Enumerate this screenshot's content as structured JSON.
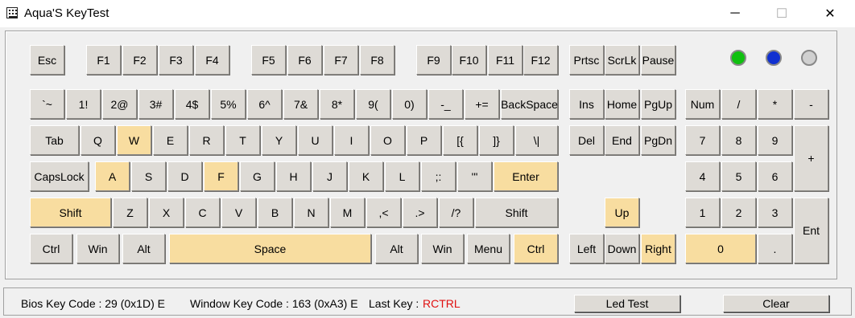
{
  "window": {
    "title": "Aqua'S KeyTest",
    "minimize_glyph": "─",
    "maximize_glyph": "☐",
    "close_glyph": "✕"
  },
  "keys": {
    "esc": "Esc",
    "f1": "F1",
    "f2": "F2",
    "f3": "F3",
    "f4": "F4",
    "f5": "F5",
    "f6": "F6",
    "f7": "F7",
    "f8": "F8",
    "f9": "F9",
    "f10": "F10",
    "f11": "F11",
    "f12": "F12",
    "prtsc": "Prtsc",
    "scrlk": "ScrLk",
    "pause": "Pause",
    "backtick": "`~",
    "k1": "1!",
    "k2": "2@",
    "k3": "3#",
    "k4": "4$",
    "k5": "5%",
    "k6": "6^",
    "k7": "7&",
    "k8": "8*",
    "k9": "9(",
    "k0": "0)",
    "minus": "-_",
    "equals": "+=",
    "backspace": "BackSpace",
    "ins": "Ins",
    "home": "Home",
    "pgup": "PgUp",
    "num": "Num",
    "np_div": "/",
    "np_mul": "*",
    "np_sub": "-",
    "tab": "Tab",
    "q": "Q",
    "w": "W",
    "e": "E",
    "r": "R",
    "t": "T",
    "y": "Y",
    "u": "U",
    "i": "I",
    "o": "O",
    "p": "P",
    "lbracket": "[{",
    "rbracket": "]}",
    "backslash": "\\|",
    "del": "Del",
    "end": "End",
    "pgdn": "PgDn",
    "np7": "7",
    "np8": "8",
    "np9": "9",
    "np_add": "+",
    "capslock": "CapsLock",
    "a": "A",
    "s": "S",
    "d": "D",
    "f": "F",
    "g": "G",
    "h": "H",
    "j": "J",
    "k": "K",
    "l": "L",
    "semicolon": ";:",
    "quote": "'\"",
    "enter": "Enter",
    "np4": "4",
    "np5": "5",
    "np6": "6",
    "lshift": "Shift",
    "z": "Z",
    "x": "X",
    "c": "C",
    "v": "V",
    "b": "B",
    "n": "N",
    "m": "M",
    "comma": ",<",
    "period": ".>",
    "slash": "/?",
    "rshift": "Shift",
    "up": "Up",
    "np1": "1",
    "np2": "2",
    "np3": "3",
    "np_enter": "Ent",
    "lctrl": "Ctrl",
    "lwin": "Win",
    "lalt": "Alt",
    "space": "Space",
    "ralt": "Alt",
    "rwin": "Win",
    "menu": "Menu",
    "rctrl": "Ctrl",
    "left": "Left",
    "down": "Down",
    "right": "Right",
    "np0": "0",
    "np_dot": "."
  },
  "highlighted_keys": [
    "w",
    "a",
    "f",
    "enter",
    "lshift",
    "space",
    "rctrl",
    "up",
    "right",
    "np0"
  ],
  "leds": {
    "num_lock_color": "#10c010",
    "caps_lock_color": "#1030d0",
    "scroll_lock_color": "#d0d0d0"
  },
  "status": {
    "bios_key_code": "Bios Key Code : 29 (0x1D) E",
    "window_key_code": "Window Key Code : 163 (0xA3) E",
    "last_key_label": "Last Key :",
    "last_key_value": "RCTRL",
    "led_test_label": "Led Test",
    "clear_label": "Clear"
  }
}
